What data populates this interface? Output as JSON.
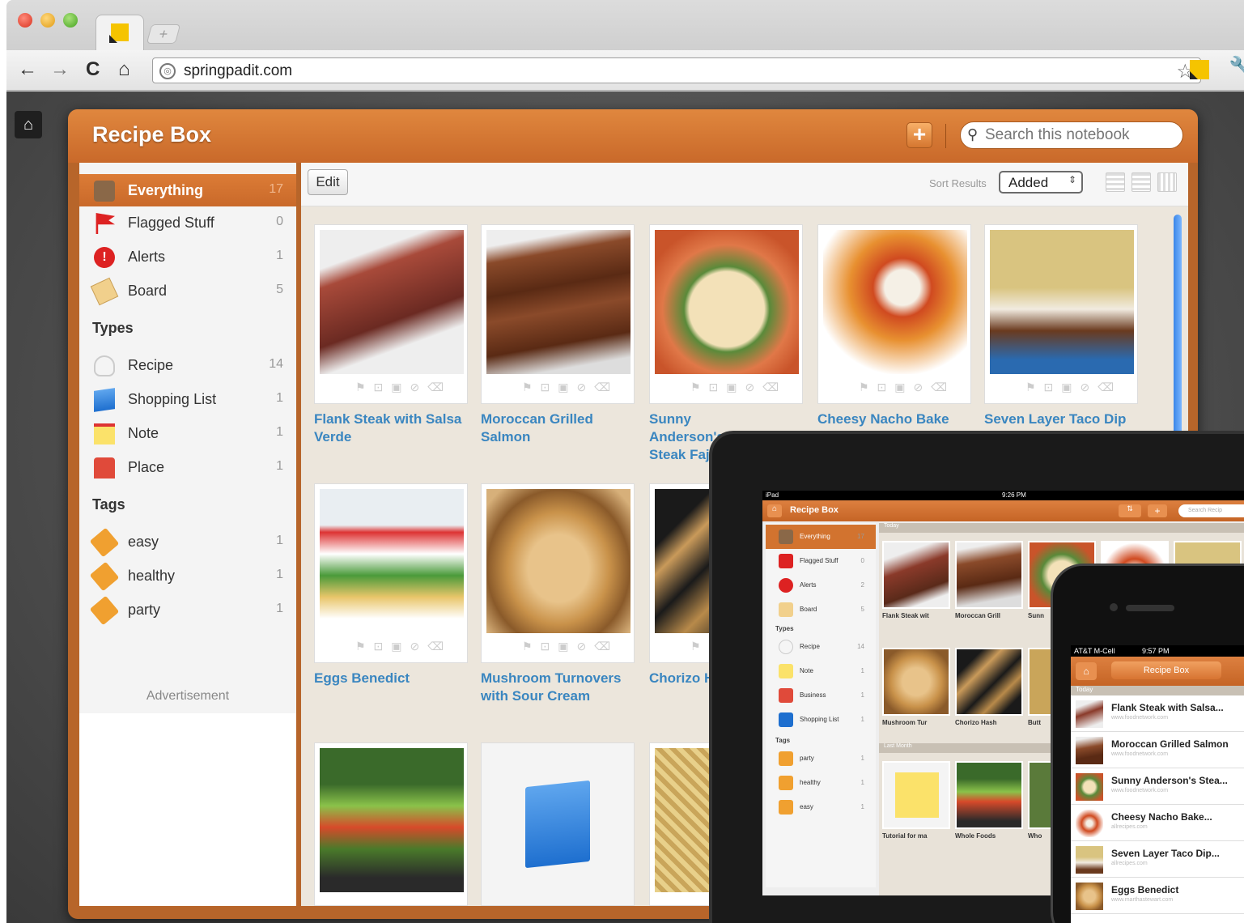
{
  "browser": {
    "url": "springpadit.com"
  },
  "app": {
    "title": "Recipe Box",
    "search_placeholder": "Search this notebook"
  },
  "sidebar": {
    "items": [
      {
        "label": "Everything",
        "count": "17"
      },
      {
        "label": "Flagged Stuff",
        "count": "0"
      },
      {
        "label": "Alerts",
        "count": "1"
      },
      {
        "label": "Board",
        "count": "5"
      }
    ],
    "types_heading": "Types",
    "types": [
      {
        "label": "Recipe",
        "count": "14"
      },
      {
        "label": "Shopping List",
        "count": "1"
      },
      {
        "label": "Note",
        "count": "1"
      },
      {
        "label": "Place",
        "count": "1"
      }
    ],
    "tags_heading": "Tags",
    "tags": [
      {
        "label": "easy",
        "count": "1"
      },
      {
        "label": "healthy",
        "count": "1"
      },
      {
        "label": "party",
        "count": "1"
      }
    ],
    "advertisement": "Advertisement"
  },
  "toolbar": {
    "edit_label": "Edit",
    "sort_label": "Sort Results",
    "sort_value": "Added"
  },
  "cards": [
    {
      "title": "Flank Steak with Salsa Verde"
    },
    {
      "title": "Moroccan Grilled Salmon"
    },
    {
      "title": "Sunny Anderson's Steak Fajita"
    },
    {
      "title": "Cheesy Nacho Bake"
    },
    {
      "title": "Seven Layer Taco Dip"
    },
    {
      "title": "Eggs Benedict"
    },
    {
      "title": "Mushroom Turnovers with Sour Cream"
    },
    {
      "title": "Chorizo H"
    }
  ],
  "ipad": {
    "status_left": "iPad",
    "status_time": "9:26 PM",
    "title": "Recipe Box",
    "search": "Search Recip",
    "today": "Today",
    "last_month": "Last Month",
    "side": [
      {
        "label": "Everything",
        "count": "17"
      },
      {
        "label": "Flagged Stuff",
        "count": "0"
      },
      {
        "label": "Alerts",
        "count": "2"
      },
      {
        "label": "Board",
        "count": "5"
      }
    ],
    "types_heading": "Types",
    "types": [
      {
        "label": "Recipe",
        "count": "14"
      },
      {
        "label": "Note",
        "count": "1"
      },
      {
        "label": "Business",
        "count": "1"
      },
      {
        "label": "Shopping List",
        "count": "1"
      }
    ],
    "tags_heading": "Tags",
    "tags": [
      {
        "label": "party",
        "count": "1"
      },
      {
        "label": "healthy",
        "count": "1"
      },
      {
        "label": "easy",
        "count": "1"
      }
    ],
    "row1_captions": [
      "Flank Steak wit",
      "Moroccan Grill",
      "Sunn"
    ],
    "row2_captions": [
      "Mushroom Tur",
      "Chorizo Hash",
      "Butt"
    ],
    "row3_captions": [
      "Tutorial for ma",
      "Whole Foods",
      "Who"
    ]
  },
  "iphone": {
    "carrier": "AT&T M-Cell",
    "time": "9:57 PM",
    "title": "Recipe Box",
    "today": "Today",
    "items": [
      {
        "name": "Flank Steak with Salsa...",
        "source": "www.foodnetwork.com"
      },
      {
        "name": "Moroccan Grilled Salmon",
        "source": "www.foodnetwork.com"
      },
      {
        "name": "Sunny Anderson's Stea...",
        "source": "www.foodnetwork.com"
      },
      {
        "name": "Cheesy Nacho Bake...",
        "source": "allrecipes.com"
      },
      {
        "name": "Seven Layer Taco Dip...",
        "source": "allrecipes.com"
      },
      {
        "name": "Eggs Benedict",
        "source": "www.marthastewart.com"
      }
    ]
  },
  "colors": {
    "accent": "#c9692a",
    "link": "#3a86c0",
    "background": "#ece6dc"
  }
}
